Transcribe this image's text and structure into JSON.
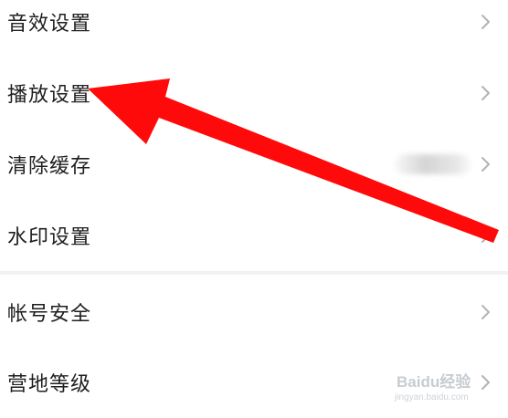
{
  "settings": {
    "items": [
      {
        "label": "音效设置",
        "icon": "chevron-right-icon"
      },
      {
        "label": "播放设置",
        "icon": "chevron-right-icon"
      },
      {
        "label": "清除缓存",
        "icon": "chevron-right-icon",
        "value_blurred": true
      },
      {
        "label": "水印设置",
        "icon": "chevron-right-icon"
      },
      {
        "label": "帐号安全",
        "icon": "chevron-right-icon"
      },
      {
        "label": "营地等级",
        "icon": "chevron-right-icon"
      }
    ]
  },
  "annotation": {
    "arrow_color": "#ff0a0a",
    "points_to": "播放设置"
  },
  "watermark": {
    "text": "Baidu经验",
    "subtext": "jingyan.baidu.com",
    "color": "#9aa3ad"
  },
  "colors": {
    "background": "#ffffff",
    "label": "#1f1f1f",
    "chevron": "#b3b3b3",
    "divider": "#f2f2f6"
  }
}
